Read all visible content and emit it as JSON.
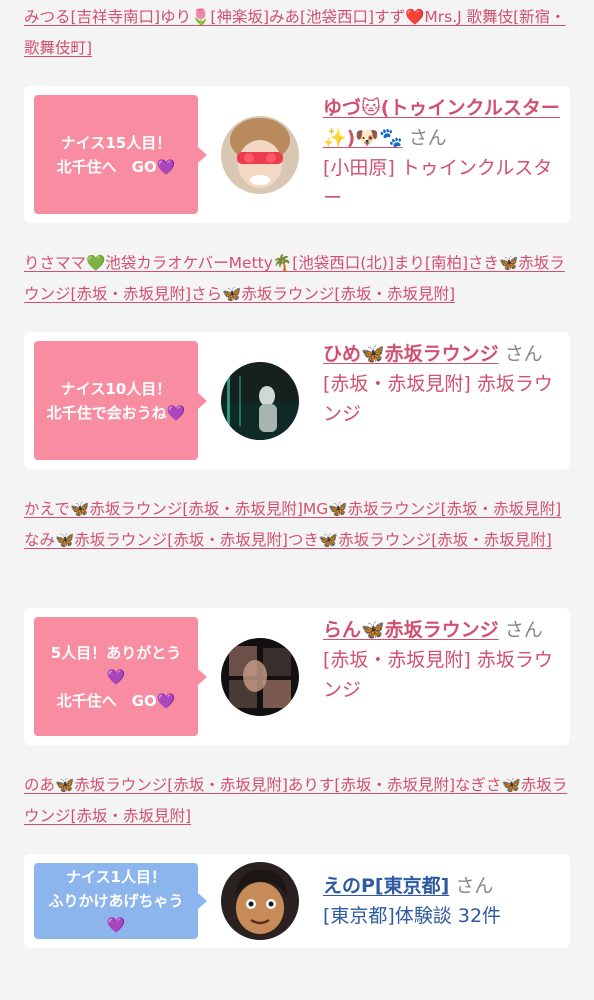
{
  "strips": [
    {
      "text": "みつる[吉祥寺南口]ゆり🌷[神楽坂]みあ[池袋西口]すず❤️Mrs.J 歌舞伎[新宿・歌舞伎町]"
    },
    {
      "text": "りさママ💚池袋カラオケバーMetty🌴[池袋西口(北)]まり[南柏]さき🦋赤坂ラウンジ[赤坂・赤坂見附]さら🦋赤坂ラウンジ[赤坂・赤坂見附]"
    },
    {
      "text": "かえで🦋赤坂ラウンジ[赤坂・赤坂見附]MG🦋赤坂ラウンジ[赤坂・赤坂見附]なみ🦋赤坂ラウンジ[赤坂・赤坂見附]つき🦋赤坂ラウンジ[赤坂・赤坂見附]"
    },
    {
      "text": "のあ🦋赤坂ラウンジ[赤坂・赤坂見附]ありす[赤坂・赤坂見附]なぎさ🦋赤坂ラウンジ[赤坂・赤坂見附]"
    }
  ],
  "cards": [
    {
      "bubble": "ナイス15人目！\n北千住へ　GO💜",
      "bubble_color": "#f88da1",
      "name": "ゆづ🐱(トゥインクルスター✨)🐶🐾",
      "honorific": "さん",
      "shop": "[小田原] トゥインクルスター"
    },
    {
      "bubble": "ナイス10人目！\n北千住で会おうね💜",
      "bubble_color": "#f88da1",
      "name": "ひめ🦋赤坂ラウンジ",
      "honorific": "さん",
      "shop": "[赤坂・赤坂見附] 赤坂ラウンジ"
    },
    {
      "bubble": "5人目！ありがとう💜\n北千住へ　GO💜",
      "bubble_color": "#f88da1",
      "name": "らん🦋赤坂ラウンジ",
      "honorific": "さん",
      "shop": "[赤坂・赤坂見附] 赤坂ラウンジ"
    },
    {
      "bubble": "ナイス1人目！\nふりかけあげちゃう💜",
      "bubble_color": "#8cb5ee",
      "name": "えのP[東京都]",
      "honorific": "さん",
      "shop": "[東京都]体験談 32件"
    }
  ]
}
